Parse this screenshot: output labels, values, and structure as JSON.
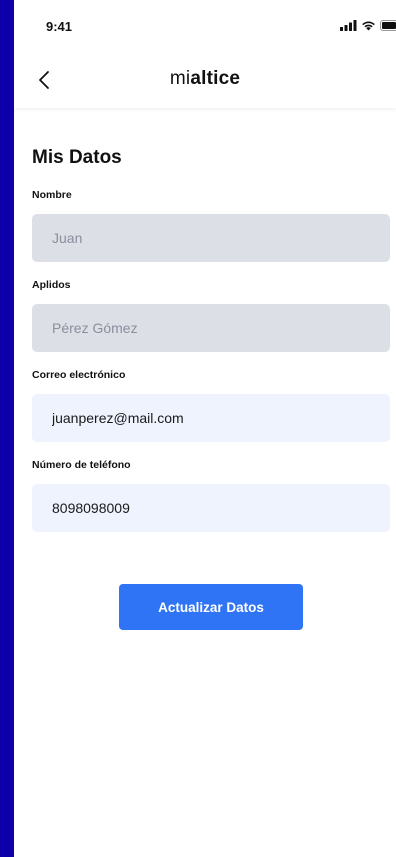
{
  "status_bar": {
    "time": "9:41"
  },
  "header": {
    "logo_light": "mi",
    "logo_bold": "altice"
  },
  "page": {
    "title": "Mis Datos"
  },
  "fields": [
    {
      "label": "Nombre",
      "value": "Juan",
      "editable": false
    },
    {
      "label": "Aplidos",
      "value": "Pérez Gómez",
      "editable": false
    },
    {
      "label": "Correo electrónico",
      "value": "juanperez@mail.com",
      "editable": true
    },
    {
      "label": "Número de teléfono",
      "value": "8098098009",
      "editable": true
    }
  ],
  "actions": {
    "update_label": "Actualizar Datos"
  },
  "colors": {
    "outer_background": "#0d00a8",
    "disabled_field": "#dcdfe6",
    "enabled_field": "#eef3fe",
    "primary_button": "#2f74f5"
  }
}
